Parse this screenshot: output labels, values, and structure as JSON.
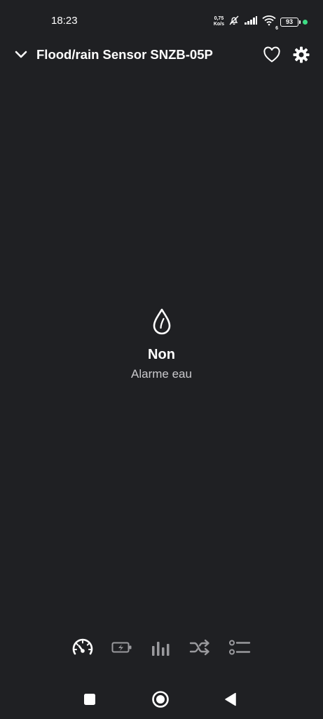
{
  "status_bar": {
    "time": "18:23",
    "net_speed_value": "0,75",
    "net_speed_unit": "Ko/s",
    "wifi_badge": "6",
    "battery_level": "93",
    "indicator_color": "#3ddc84"
  },
  "header": {
    "title": "Flood/rain Sensor SNZB-05P",
    "back_icon": "chevron-down-icon",
    "favorite_icon": "heart-outline-icon",
    "settings_icon": "gear-icon"
  },
  "sensor": {
    "icon": "water-drop-icon",
    "value": "Non",
    "label": "Alarme eau"
  },
  "tabs": [
    {
      "icon": "speedometer-icon",
      "active": true
    },
    {
      "icon": "battery-charging-icon",
      "active": false
    },
    {
      "icon": "bar-chart-icon",
      "active": false
    },
    {
      "icon": "shuffle-icon",
      "active": false
    },
    {
      "icon": "list-icon",
      "active": false
    }
  ],
  "colors": {
    "background": "#1f2023",
    "active_tab": "#ffffff",
    "inactive_tab": "#9a9a9e",
    "secondary_text": "#c9c9cc"
  },
  "nav": {
    "recents_icon": "square-icon",
    "home_icon": "circle-icon",
    "back_icon": "triangle-back-icon"
  }
}
